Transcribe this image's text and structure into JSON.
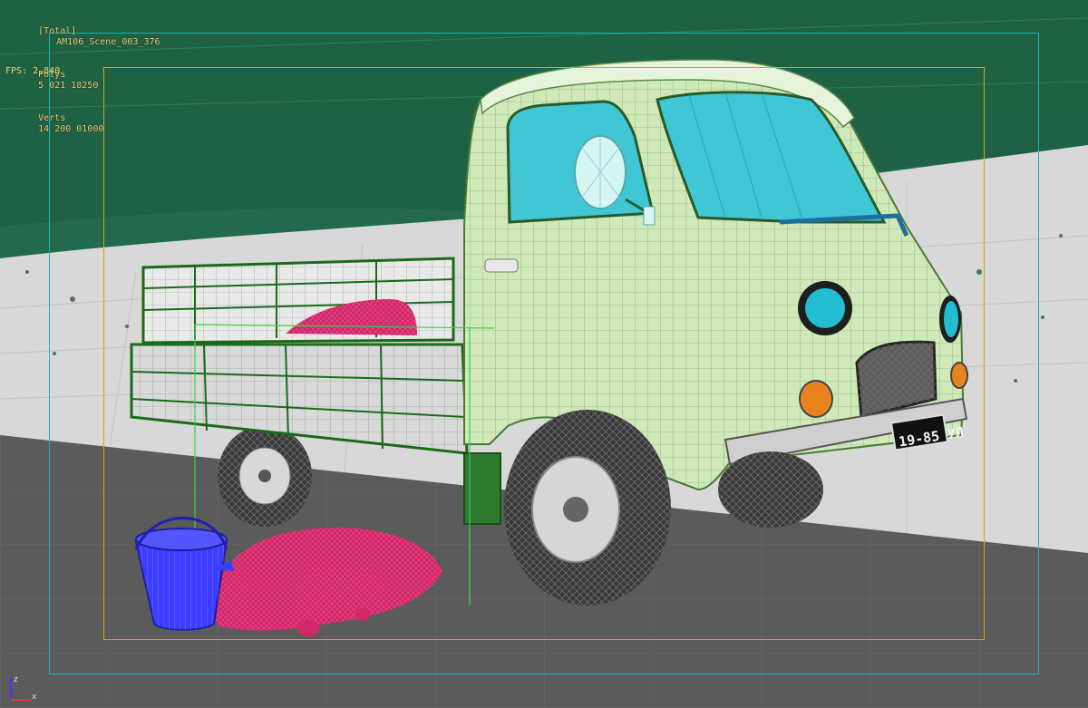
{
  "viewport": {
    "label": "[Total]",
    "object_name": "AM106_Scene_003_376",
    "stats": [
      {
        "label": "Polys",
        "value": "5 021 18250"
      },
      {
        "label": "Verts",
        "value": "14 200 01000"
      }
    ],
    "fps": {
      "label": "FPS:",
      "value": "2.840"
    }
  },
  "scene": {
    "license_plate": "19-85 УЛ",
    "objects": [
      "truck-cab",
      "cargo-bed",
      "front-wheel",
      "rear-wheel",
      "bucket",
      "potato-pile",
      "background-foliage",
      "ground-plane"
    ]
  },
  "gizmo": {
    "z_label": "z",
    "x_label": "x"
  },
  "colors": {
    "foliage": "#1f6b4a",
    "cab": "#cfe9b8",
    "windows": "#40c7d6",
    "potatoes": "#d2286a",
    "bucket": "#3d3dff",
    "safe_frame_outer": "#19b6b6",
    "safe_frame_inner": "#c9a52b"
  }
}
